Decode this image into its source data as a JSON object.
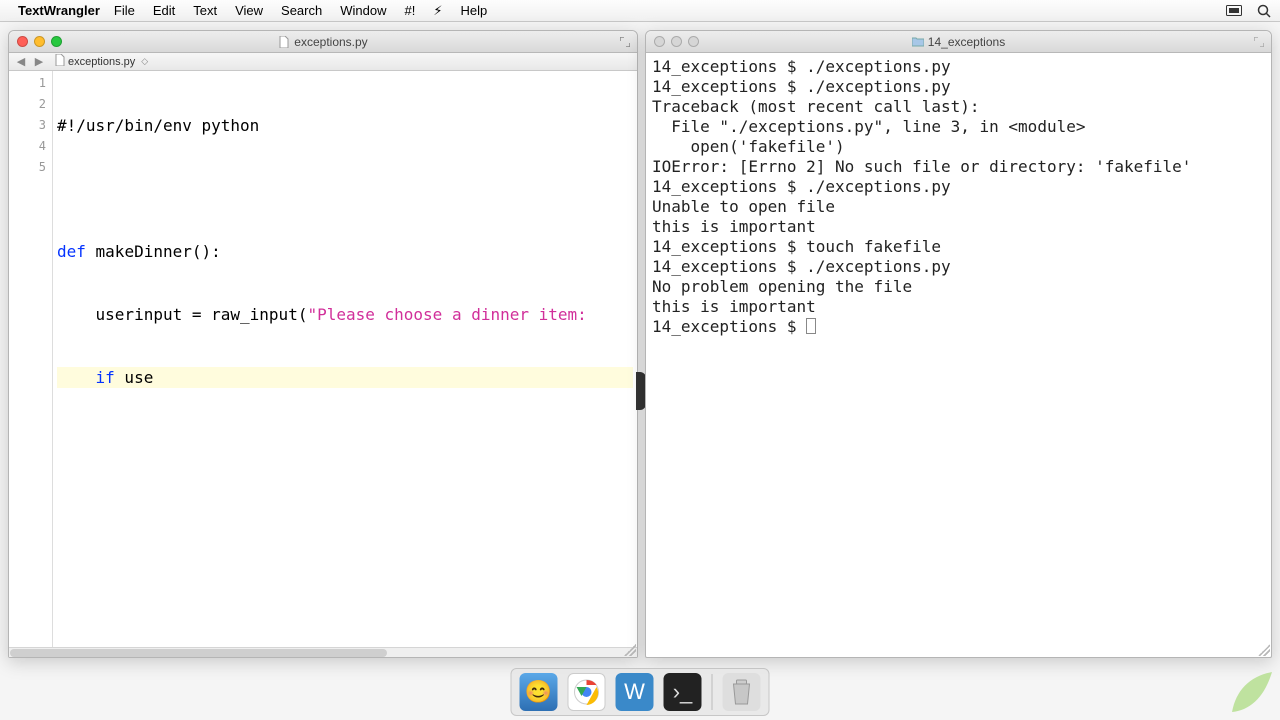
{
  "menubar": {
    "app": "TextWrangler",
    "items": [
      "File",
      "Edit",
      "Text",
      "View",
      "Search",
      "Window",
      "#!",
      "⚡︎",
      "Help"
    ]
  },
  "left_window": {
    "title": "exceptions.py",
    "nav_filename": "exceptions.py",
    "line_numbers": [
      1,
      2,
      3,
      4,
      5
    ],
    "code": {
      "l1": "#!/usr/bin/env python",
      "l2": "",
      "l3_kw": "def",
      "l3_name": " makeDinner():",
      "l4a": "    userinput = raw_input(",
      "l4_str": "\"Please choose a dinner item:",
      "l5_if": "    if",
      "l5_rest": " use"
    }
  },
  "right_window": {
    "title": "14_exceptions",
    "lines": [
      "14_exceptions $ ./exceptions.py",
      "14_exceptions $ ./exceptions.py",
      "Traceback (most recent call last):",
      "  File \"./exceptions.py\", line 3, in <module>",
      "    open('fakefile')",
      "IOError: [Errno 2] No such file or directory: 'fakefile'",
      "14_exceptions $ ./exceptions.py",
      "Unable to open file",
      "this is important",
      "14_exceptions $ touch fakefile",
      "14_exceptions $ ./exceptions.py",
      "No problem opening the file",
      "this is important"
    ],
    "prompt": "14_exceptions $ "
  },
  "dock": {
    "items": [
      "finder",
      "chrome",
      "textwrangler",
      "terminal"
    ],
    "trash": "trash"
  }
}
